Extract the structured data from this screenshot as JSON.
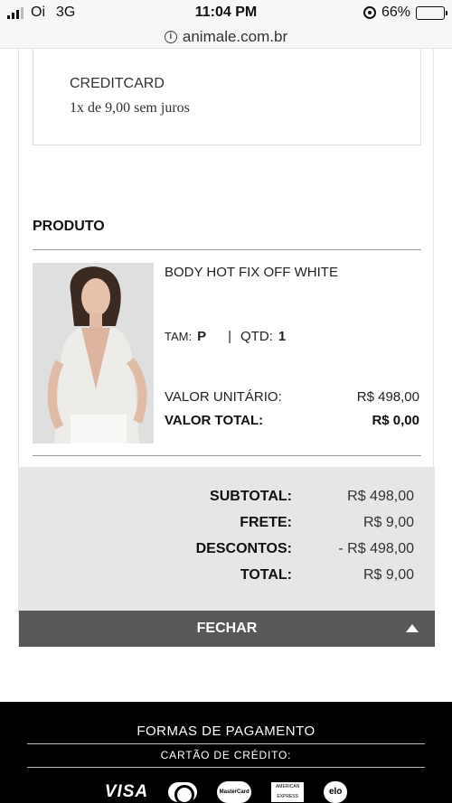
{
  "status_bar": {
    "carrier": "Oi",
    "network": "3G",
    "time": "11:04 PM",
    "battery": "66%",
    "battery_level": 0.66
  },
  "url_bar": {
    "url": "animale.com.br"
  },
  "payment": {
    "method": "CREDITCARD",
    "installments": "1x de 9,00 sem juros"
  },
  "produto": {
    "title": "PRODUTO",
    "name": "BODY HOT FIX OFF WHITE",
    "size_label": "TAM:",
    "size": "P",
    "separator": "|",
    "qty_label": "QTD:",
    "qty": "1",
    "unit_label": "VALOR UNITÁRIO:",
    "unit_value": "R$ 498,00",
    "total_label": "VALOR TOTAL:",
    "total_value": "R$ 0,00"
  },
  "summary": [
    {
      "label": "SUBTOTAL:",
      "value": "R$ 498,00"
    },
    {
      "label": "FRETE:",
      "value": "R$ 9,00"
    },
    {
      "label": "DESCONTOS:",
      "value": "- R$ 498,00"
    },
    {
      "label": "TOTAL:",
      "value": "R$ 9,00"
    }
  ],
  "close_button": {
    "label": "FECHAR"
  },
  "footer": {
    "title": "FORMAS DE PAGAMENTO",
    "subtitle": "CARTÃO DE CRÉDITO:",
    "cards": {
      "visa": "VISA",
      "mastercard": "MasterCard",
      "amex": "AMERICAN EXPRESS",
      "elo": "elo"
    }
  }
}
